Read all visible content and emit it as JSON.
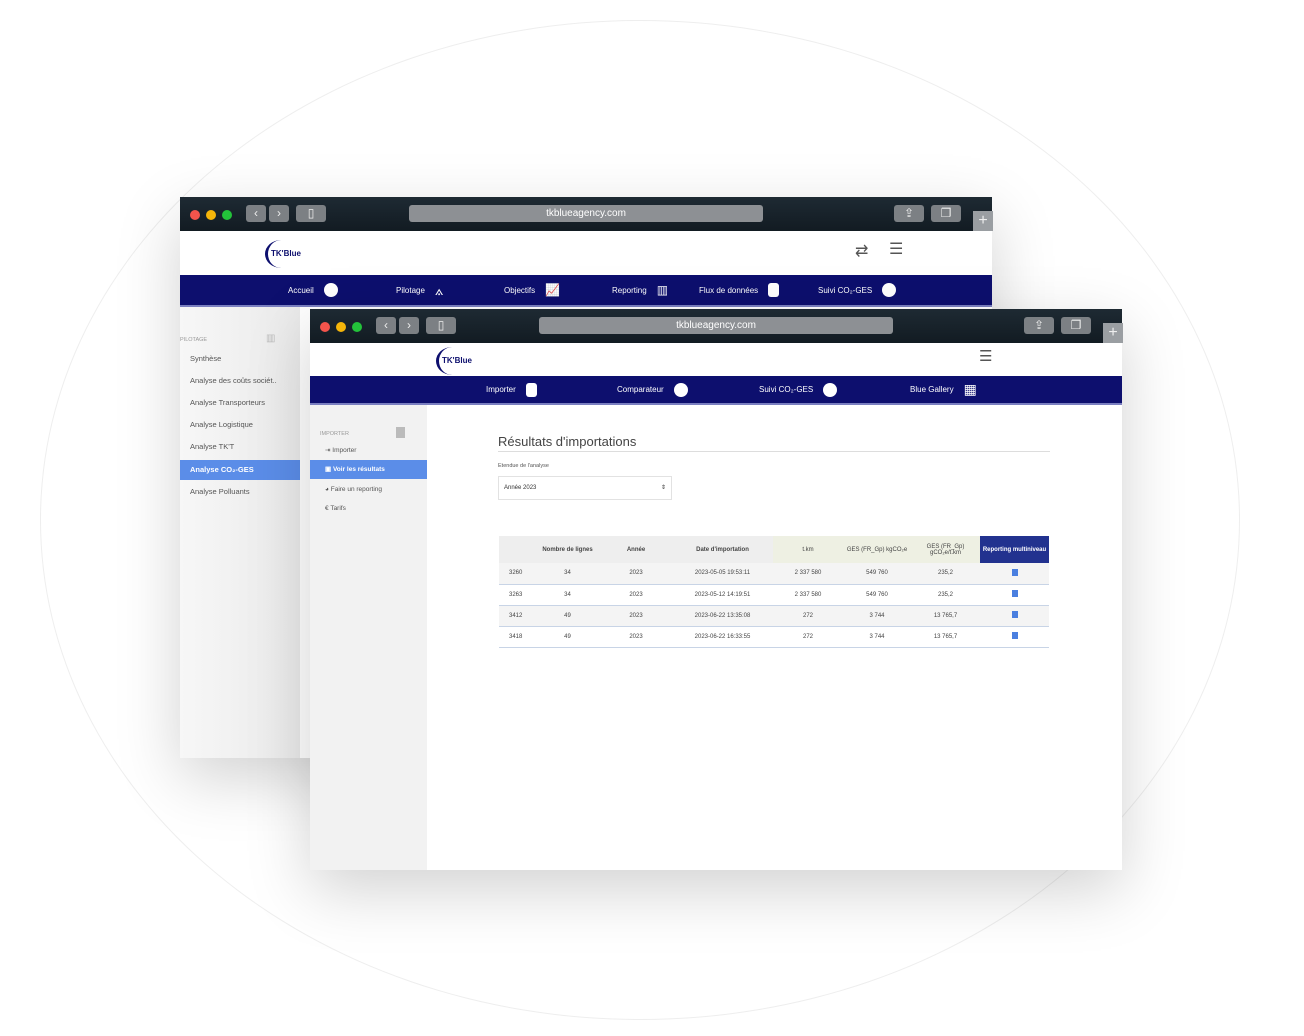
{
  "back_window": {
    "url": "tkblueagency.com",
    "logo": "TK'Blue",
    "nav": [
      "Accueil",
      "Pilotage",
      "Objectifs",
      "Reporting",
      "Flux de données",
      "Suivi CO₂-GES"
    ],
    "sidebar": {
      "section": "PILOTAGE",
      "items": [
        "Synthèse",
        "Analyse des coûts sociét..",
        "Analyse Transporteurs",
        "Analyse Logistique",
        "Analyse TK'T",
        "Analyse CO₂-GES",
        "Analyse Polluants"
      ],
      "active": 5
    }
  },
  "front_window": {
    "url": "tkblueagency.com",
    "logo": "TK'Blue",
    "nav": [
      "Importer",
      "Comparateur",
      "Suivi CO₂-GES",
      "Blue Gallery"
    ],
    "sidebar": {
      "section": "IMPORTER",
      "items": [
        "Importer",
        "Voir les résultats",
        "Faire un reporting",
        "Tarifs"
      ],
      "icons": [
        "import-icon",
        "results-icon",
        "pie-icon",
        "euro-icon"
      ],
      "active": 1
    },
    "main": {
      "title": "Résultats d'importations",
      "scope_label": "Etendue de l'analyse",
      "scope_value": "Année 2023",
      "table": {
        "headers": [
          "",
          "Nombre de lignes",
          "Année",
          "Date d'importation",
          "t.km",
          "GES (FR_Gp) kgCO₂e",
          "GES (FR_Gp) gCO₂e/t.km",
          "Reporting multiniveau"
        ],
        "rows": [
          [
            "3260",
            "34",
            "2023",
            "2023-05-05 19:53:11",
            "2 337 580",
            "549 760",
            "235,2"
          ],
          [
            "3263",
            "34",
            "2023",
            "2023-05-12 14:19:51",
            "2 337 580",
            "549 760",
            "235,2"
          ],
          [
            "3412",
            "49",
            "2023",
            "2023-06-22 13:35:08",
            "272",
            "3 744",
            "13 765,7"
          ],
          [
            "3418",
            "49",
            "2023",
            "2023-06-22 16:33:55",
            "272",
            "3 744",
            "13 765,7"
          ]
        ]
      }
    }
  },
  "colors": {
    "nav": "#0d0f6e",
    "active": "#5b8de8",
    "reporting_header": "#22328f"
  }
}
